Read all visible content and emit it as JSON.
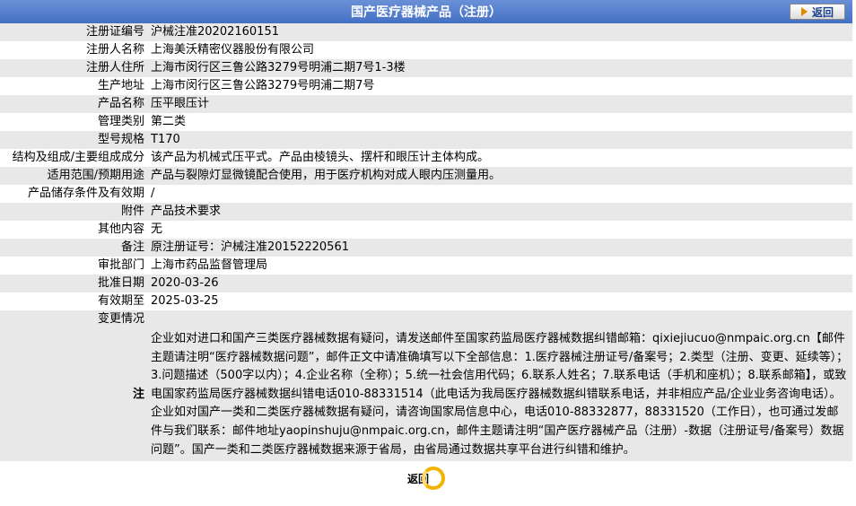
{
  "header": {
    "title": "国产医疗器械产品（注册）",
    "back_label": "返回"
  },
  "rows": [
    {
      "label": "注册证编号",
      "value": "沪械注准20202160151"
    },
    {
      "label": "注册人名称",
      "value": "上海美沃精密仪器股份有限公司"
    },
    {
      "label": "注册人住所",
      "value": "上海市闵行区三鲁公路3279号明浦二期7号1-3楼"
    },
    {
      "label": "生产地址",
      "value": "上海市闵行区三鲁公路3279号明浦二期7号"
    },
    {
      "label": "产品名称",
      "value": "压平眼压计"
    },
    {
      "label": "管理类别",
      "value": "第二类"
    },
    {
      "label": "型号规格",
      "value": "T170"
    },
    {
      "label": "结构及组成/主要组成成分",
      "value": "该产品为机械式压平式。产品由棱镜头、摆杆和眼压计主体构成。"
    },
    {
      "label": "适用范围/预期用途",
      "value": "产品与裂隙灯显微镜配合使用，用于医疗机构对成人眼内压测量用。"
    },
    {
      "label": "产品储存条件及有效期",
      "value": "/"
    },
    {
      "label": "附件",
      "value": "产品技术要求"
    },
    {
      "label": "其他内容",
      "value": "无"
    },
    {
      "label": "备注",
      "value": "原注册证号：沪械注准20152220561"
    },
    {
      "label": "审批部门",
      "value": "上海市药品监督管理局"
    },
    {
      "label": "批准日期",
      "value": "2020-03-26"
    },
    {
      "label": "有效期至",
      "value": "2025-03-25"
    },
    {
      "label": "变更情况",
      "value": ""
    }
  ],
  "note": {
    "label": "注",
    "text": "企业如对进口和国产三类医疗器械数据有疑问，请发送邮件至国家药监局医疗器械数据纠错邮箱：qixiejiucuo@nmpaic.org.cn【邮件主题请注明“医疗器械数据问题”，邮件正文中请准确填写以下全部信息：1.医疗器械注册证号/备案号；2.类型（注册、变更、延续等）；3.问题描述（500字以内）；4.企业名称（全称）；5.统一社会信用代码；6.联系人姓名；7.联系电话（手机和座机）；8.联系邮箱】，或致电国家药监局医疗器械数据纠错电话010-88331514（此电话为我局医疗器械数据纠错联系电话，并非相应产品/企业业务咨询电话）。企业如对国产一类和二类医疗器械数据有疑问，请咨询国家局信息中心，电话010-88332877，88331520（工作日），也可通过发邮件与我们联系：邮件地址yaopinshuju@nmpaic.org.cn，邮件主题请注明“国产医疗器械产品（注册）-数据（注册证号/备案号）数据问题”。国产一类和二类医疗器械数据来源于省局，由省局通过数据共享平台进行纠错和维护。"
  },
  "footer": {
    "back_label": "返回"
  },
  "colors": {
    "header_bg": "#4a76c8",
    "row_alt": "#e8e8e8",
    "back_ring": "#f0b400"
  }
}
